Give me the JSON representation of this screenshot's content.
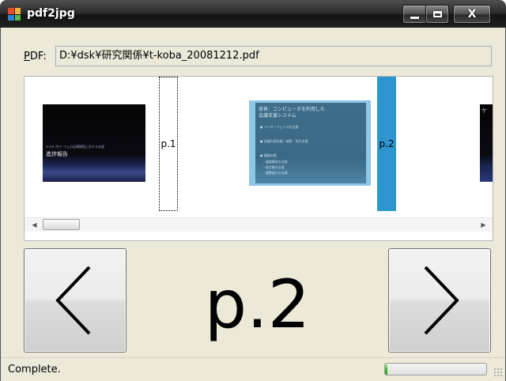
{
  "window": {
    "title": "pdf2jpg",
    "close_glyph": "X"
  },
  "pdf": {
    "label": "DF:",
    "label_mnemonic": "P",
    "path": "D:¥dsk¥研究関係¥t-koba_20081212.pdf"
  },
  "thumbnails": [
    {
      "page_label": "p.1",
      "small_text": "ｷｬﾗｸﾀｰがﾒﾃﾞｨｱ上の記事観覧における支援",
      "title_text": "進捗報告",
      "selected": false
    },
    {
      "page_label": "p.2",
      "title_line1": "背景：コンピュータを利用した",
      "title_line2": "会議支援システム",
      "bullets": [
        "● インターフェイスを支援",
        "● 会議内容記録・検索・再生支援",
        "● 議論支援",
        "　- 議論構造の支援",
        "　- 発言権の支援",
        "　- 議題進行の支援"
      ],
      "selected": true
    },
    {
      "page_label": "",
      "partial_text": "ケ"
    }
  ],
  "navigation": {
    "current_page": "p.2"
  },
  "status": {
    "text": "Complete.",
    "progress_percent": 2
  },
  "colors": {
    "selection_blue": "#2e96cf",
    "progress_green": "#37b82a"
  },
  "icons": {
    "app": "pdf2jpg-app-icon",
    "prev": "chevron-left-icon",
    "next": "chevron-right-icon"
  }
}
